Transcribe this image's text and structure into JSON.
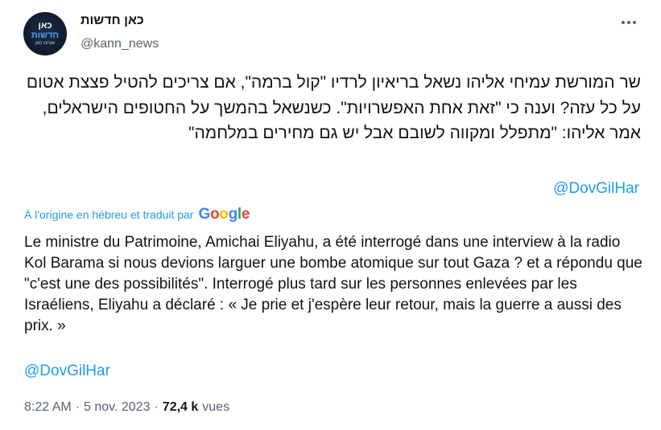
{
  "author": {
    "display_name": "כאן חדשות",
    "handle": "@kann_news",
    "avatar": {
      "line1": "כאן",
      "line2": "חדשות",
      "line3": "אנחנו כאן",
      "bg_color": "#101a2c",
      "accent": "#4aa3ff"
    }
  },
  "menu": {
    "icon": "more-horizontal-icon"
  },
  "tweet": {
    "hebrew_text": "שר המורשת עמיחי אליהו נשאל בריאיון לרדיו \"קול ברמה\", אם צריכים להטיל פצצת אטום על כל עזה? וענה כי \"זאת אחת האפשרויות\". כשנשאל בהמשך על החטופים הישראלים, אמר אליהו: \"מתפלל ומקווה לשובם אבל יש גם מחירים במלחמה\"",
    "hebrew_mention": "@DovGilHar",
    "translation_label": "À l'origine en hébreu et traduit par",
    "translator_logo": {
      "G": "G",
      "o1": "o",
      "o2": "o",
      "g": "g",
      "l": "l",
      "e": "e"
    },
    "french_text": "Le ministre du Patrimoine, Amichai Eliyahu, a été interrogé dans une interview à la radio Kol Barama si nous devions larguer une bombe atomique sur tout Gaza ? et a répondu que \"c'est une des possibilités\". Interrogé plus tard sur les personnes enlevées par les Israéliens, Eliyahu a déclaré : « Je prie et j'espère leur retour, mais la guerre a aussi des prix. »",
    "french_mention": "@DovGilHar"
  },
  "meta": {
    "time": "8:22 AM",
    "separator": "·",
    "date": "5 nov. 2023",
    "views_count": "72,4 k",
    "views_label": "vues"
  },
  "colors": {
    "link": "#1d9bf0",
    "text": "#0f1419",
    "secondary": "#536471"
  }
}
